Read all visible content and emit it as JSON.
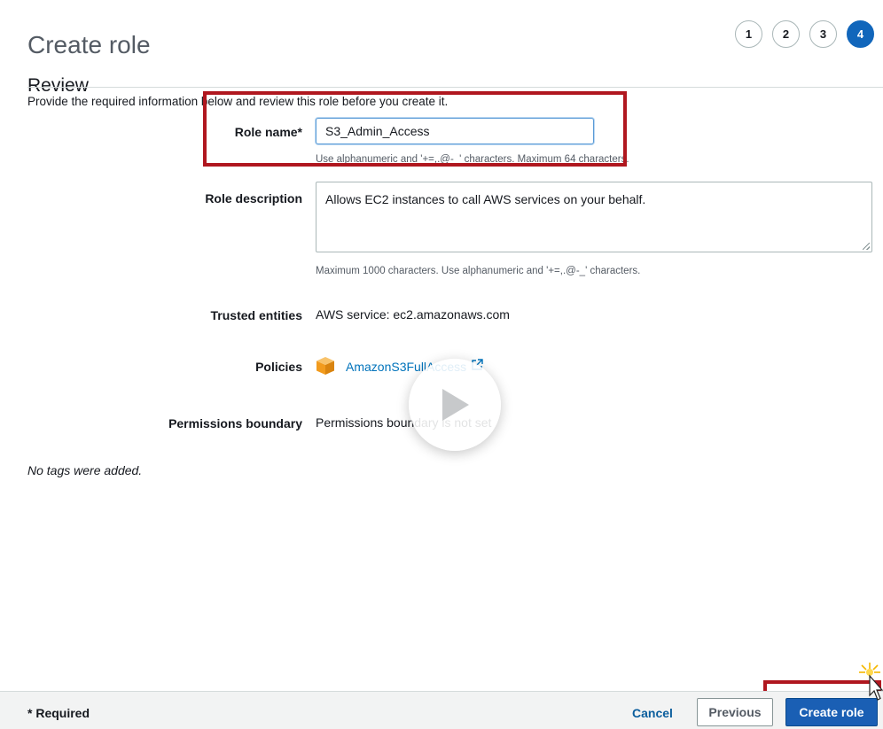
{
  "header": {
    "title": "Create role",
    "section": "Review",
    "steps": [
      "1",
      "2",
      "3",
      "4"
    ],
    "active_step": "4"
  },
  "intro": "Provide the required information below and review this role before you create it.",
  "form": {
    "role_name": {
      "label": "Role name*",
      "value": "S3_Admin_Access",
      "hint": "Use alphanumeric and '+=,.@-_' characters. Maximum 64 characters."
    },
    "role_description": {
      "label": "Role description",
      "value": "Allows EC2 instances to call AWS services on your behalf.",
      "hint": "Maximum 1000 characters. Use alphanumeric and '+=,.@-_' characters."
    },
    "trusted_entities": {
      "label": "Trusted entities",
      "value": "AWS service: ec2.amazonaws.com"
    },
    "policies": {
      "label": "Policies",
      "items": [
        "AmazonS3FullAccess"
      ]
    },
    "permissions_boundary": {
      "label": "Permissions boundary",
      "value": "Permissions boundary is not set"
    },
    "tags_note": "No tags were added."
  },
  "footer": {
    "required_note": "* Required",
    "cancel": "Cancel",
    "previous": "Previous",
    "create": "Create role"
  },
  "colors": {
    "primary": "#1a5fb4",
    "link": "#0073bb",
    "annotation": "#b0171f",
    "policy_icon": "#f7a21b"
  },
  "icons": [
    "policy-package-icon",
    "external-link-icon",
    "play-icon",
    "pointer-cursor-icon"
  ]
}
